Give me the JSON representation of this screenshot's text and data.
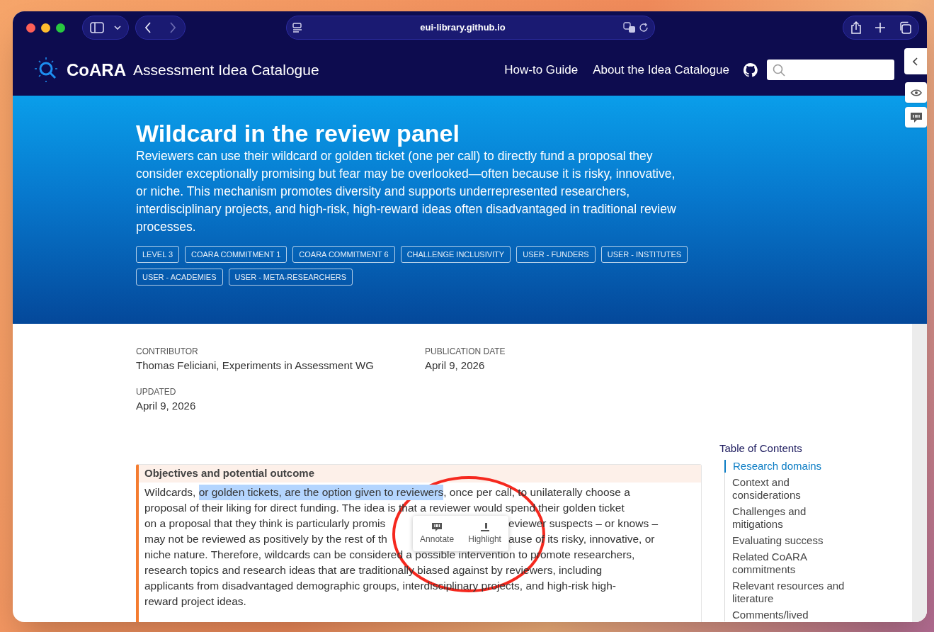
{
  "browser": {
    "url": "eui-library.github.io"
  },
  "header": {
    "logo_text": "CoARA",
    "title": "Assessment Idea Catalogue",
    "nav": [
      "How-to Guide",
      "About the Idea Catalogue"
    ]
  },
  "hero": {
    "title": "Wildcard in the review panel",
    "description": "Reviewers can use their wildcard or golden ticket (one per call) to directly fund a proposal they consider exceptionally promising but fear may be overlooked—often because it is risky, innovative, or niche. This mechanism promotes diversity and supports underrepresented researchers, interdisciplinary projects, and high-risk, high-reward ideas often disadvantaged in traditional review processes.",
    "tags": [
      "LEVEL 3",
      "COARA COMMITMENT 1",
      "COARA COMMITMENT 6",
      "CHALLENGE INCLUSIVITY",
      "USER - FUNDERS",
      "USER - INSTITUTES",
      "USER - ACADEMIES",
      "USER - META-RESEARCHERS"
    ]
  },
  "meta": [
    {
      "label": "CONTRIBUTOR",
      "value": "Thomas Feliciani, Experiments in Assessment WG"
    },
    {
      "label": "PUBLICATION DATE",
      "value": "April 9, 2026"
    },
    {
      "label": "UPDATED",
      "value": "April 9, 2026"
    }
  ],
  "callout": {
    "title": "Objectives and potential outcome",
    "lines": [
      {
        "parts": [
          [
            {
              "text": "Wildcards, ",
              "selected": false
            },
            {
              "text": "or golden tickets, are the option given to reviewers",
              "selected": true
            },
            {
              "text": ", once per call, to unilaterally choose a",
              "selected": false
            }
          ]
        ]
      },
      {
        "parts": [
          [
            {
              "text": "proposal of their liking for direct funding. The idea is that a reviewer would spend their golden ticket",
              "selected": false
            }
          ]
        ]
      },
      {
        "parts": [
          [
            {
              "text": "on a proposal that they think is particularly promis",
              "selected": false
            }
          ],
          [
            {
              "text": "eviewer suspects – or knows –",
              "selected": false
            }
          ]
        ]
      },
      {
        "parts": [
          [
            {
              "text": "may not be reviewed as positively by the rest of th",
              "selected": false
            }
          ],
          [
            {
              "text": "ause of its risky, innovative, or",
              "selected": false
            }
          ]
        ]
      },
      {
        "parts": [
          [
            {
              "text": "niche nature. Therefore, wildcards can be considered a possible intervention to promote researchers,",
              "selected": false
            }
          ]
        ]
      },
      {
        "parts": [
          [
            {
              "text": "research topics and research ideas that are traditionally biased against by reviewers, including",
              "selected": false
            }
          ]
        ]
      },
      {
        "parts": [
          [
            {
              "text": "applicants from disadvantaged demographic groups, interdisciplinary projects, and high-risk high-",
              "selected": false
            }
          ]
        ]
      },
      {
        "parts": [
          [
            {
              "text": "reward project ideas.",
              "selected": false
            }
          ]
        ]
      }
    ]
  },
  "popup": {
    "buttons": [
      {
        "kind": "annotate",
        "label": "Annotate"
      },
      {
        "kind": "highlight",
        "label": "Highlight"
      }
    ]
  },
  "toc": {
    "title": "Table of Contents",
    "items": [
      {
        "label": "Research domains",
        "selected": true
      },
      {
        "label": "Context and considerations",
        "selected": false
      },
      {
        "label": "Challenges and mitigations",
        "selected": false
      },
      {
        "label": "Evaluating success",
        "selected": false
      },
      {
        "label": "Related CoARA commitments",
        "selected": false
      },
      {
        "label": "Relevant resources and literature",
        "selected": false
      },
      {
        "label": "Comments/lived",
        "selected": false
      }
    ]
  }
}
